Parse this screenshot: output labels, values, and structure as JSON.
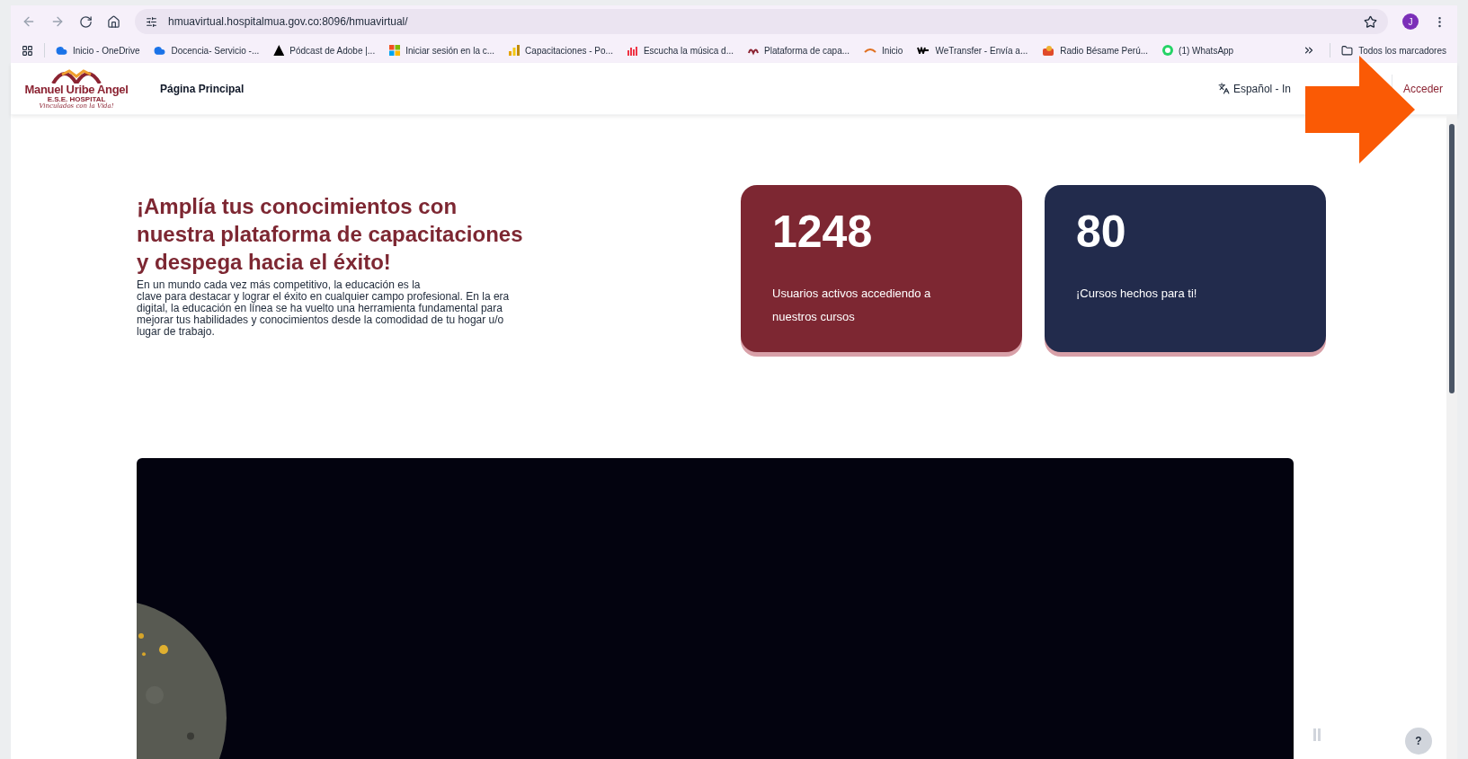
{
  "browser": {
    "url": "hmuavirtual.hospitalmua.gov.co:8096/hmuavirtual/",
    "profile": "J",
    "bookmarks": [
      {
        "label": "Inicio - OneDrive",
        "kind": "cloud"
      },
      {
        "label": "Docencia- Servicio -...",
        "kind": "cloud"
      },
      {
        "label": "Pódcast de Adobe |...",
        "kind": "adobe"
      },
      {
        "label": "Iniciar sesión en la c...",
        "kind": "windows"
      },
      {
        "label": "Capacitaciones - Po...",
        "kind": "chart"
      },
      {
        "label": "Escucha la música d...",
        "kind": "music"
      },
      {
        "label": "Plataforma de capa...",
        "kind": "logo"
      },
      {
        "label": "Inicio",
        "kind": "wave"
      },
      {
        "label": "WeTransfer - Envía a...",
        "kind": "we"
      },
      {
        "label": "Radio Bésame Perú...",
        "kind": "radio"
      },
      {
        "label": "(1) WhatsApp",
        "kind": "whatsapp"
      }
    ],
    "all_bookmarks": "Todos los marcadores"
  },
  "site": {
    "logo": {
      "name": "Manuel Uribe Angel",
      "subtitle": "E.S.E. HOSPITAL",
      "tagline": "Vinculados con la Vida!"
    },
    "nav": [
      {
        "label": "Página Principal"
      }
    ],
    "language": "Español - In",
    "login": "Acceder"
  },
  "hero": {
    "heading": "¡Amplía tus conocimientos con nuestra plataforma de capacitaciones y despega hacia el éxito!",
    "lines": [
      "En un mundo cada vez más competitivo, la educación es la",
      "clave para destacar y lograr el éxito en cualquier campo profesional. En la era",
      "digital, la educación en línea se ha vuelto una herramienta fundamental para",
      "mejorar tus habilidades y conocimientos desde la comodidad de tu hogar u/o",
      "lugar de trabajo."
    ]
  },
  "stats": [
    {
      "value": "1248",
      "label": "Usuarios activos accediendo a nuestros cursos",
      "color": "#7d2732"
    },
    {
      "value": "80",
      "label": "¡Cursos hechos para ti!",
      "color": "#222b4c"
    }
  ],
  "help": "?"
}
